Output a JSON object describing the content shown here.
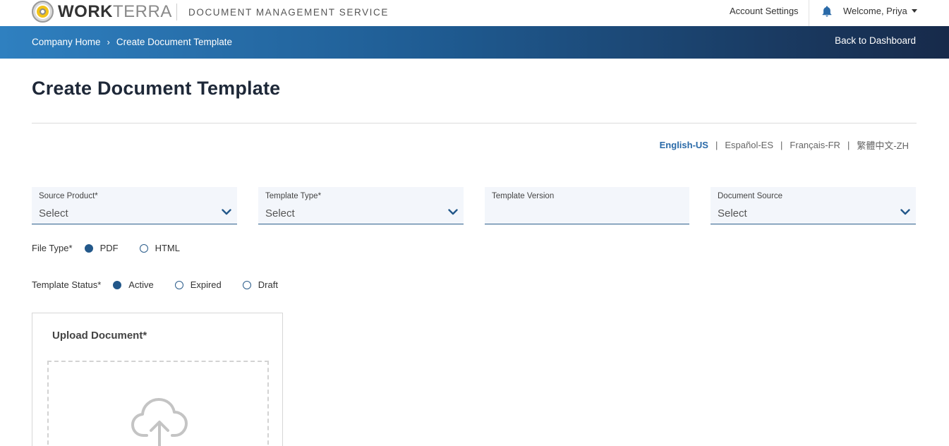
{
  "header": {
    "brand_bold": "WORK",
    "brand_light": "TERRA",
    "service_title": "DOCUMENT MANAGEMENT SERVICE",
    "account_settings": "Account Settings",
    "welcome": "Welcome, Priya"
  },
  "nav": {
    "breadcrumb_home": "Company Home",
    "breadcrumb_separator": "›",
    "breadcrumb_current": "Create Document Template",
    "back_link": "Back to Dashboard"
  },
  "page": {
    "title": "Create Document Template"
  },
  "languages": {
    "items": [
      "English-US",
      "Español-ES",
      "Français-FR",
      "繁體中文-ZH"
    ],
    "active": "English-US",
    "separator": "|"
  },
  "form": {
    "source_product": {
      "label": "Source Product*",
      "value": "Select"
    },
    "template_type": {
      "label": "Template Type*",
      "value": "Select"
    },
    "template_version": {
      "label": "Template Version",
      "value": ""
    },
    "document_source": {
      "label": "Document Source",
      "value": "Select"
    },
    "file_type": {
      "label": "File Type*",
      "options": [
        "PDF",
        "HTML"
      ],
      "selected": "PDF"
    },
    "template_status": {
      "label": "Template Status*",
      "options": [
        "Active",
        "Expired",
        "Draft"
      ],
      "selected": "Active"
    }
  },
  "upload": {
    "title": "Upload Document*"
  },
  "colors": {
    "accent": "#2a6aa8",
    "nav_start": "#2f80c0",
    "nav_end": "#172a4a",
    "field_bg": "#f3f6fb",
    "radio_checked": "#23588a"
  }
}
